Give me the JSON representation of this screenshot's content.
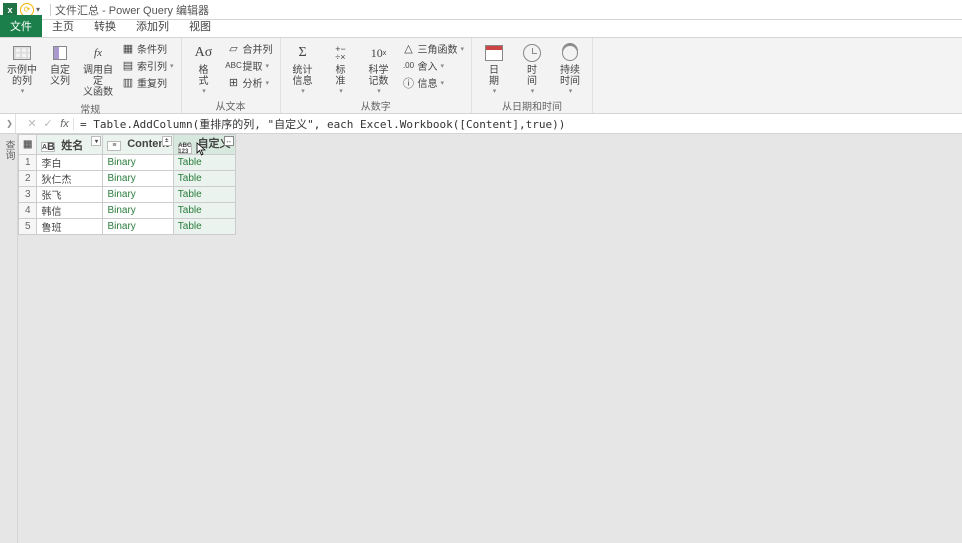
{
  "title": {
    "main": "文件汇总 - Power Query 编辑器"
  },
  "tabs": {
    "file": "文件",
    "home": "主页",
    "transform": "转换",
    "add_col": "添加列",
    "view": "视图"
  },
  "ribbon": {
    "general": {
      "examples": "示例中\n的列",
      "custom": "自定\n义列",
      "invoke": "调用自定\n义函数",
      "cond_col": "条件列",
      "index_col": "索引列",
      "duplicate": "重复列",
      "group": "常规"
    },
    "text": {
      "format": "格\n式",
      "merge": "合并列",
      "extract": "提取",
      "parse": "分析",
      "group": "从文本"
    },
    "number": {
      "stats": "统计\n信息",
      "standard": "标\n准",
      "sci": "科学\n记数",
      "trig": "三角函数",
      "round": "舍入",
      "info": "信息",
      "group": "从数字"
    },
    "datetime": {
      "date": "日\n期",
      "time": "时\n间",
      "duration": "持续\n时间",
      "group": "从日期和时间"
    }
  },
  "formula": "= Table.AddColumn(重排序的列, \"自定义\", each Excel.Workbook([Content],true))",
  "vertical_tab": "查询",
  "columns": {
    "name": "姓名",
    "content": "Content",
    "custom": "自定义"
  },
  "binary": "Binary",
  "table_val": "Table",
  "rows": [
    {
      "n": "1",
      "name": "李白"
    },
    {
      "n": "2",
      "name": "狄仁杰"
    },
    {
      "n": "3",
      "name": "张飞"
    },
    {
      "n": "4",
      "name": "韩信"
    },
    {
      "n": "5",
      "name": "鲁班"
    }
  ]
}
